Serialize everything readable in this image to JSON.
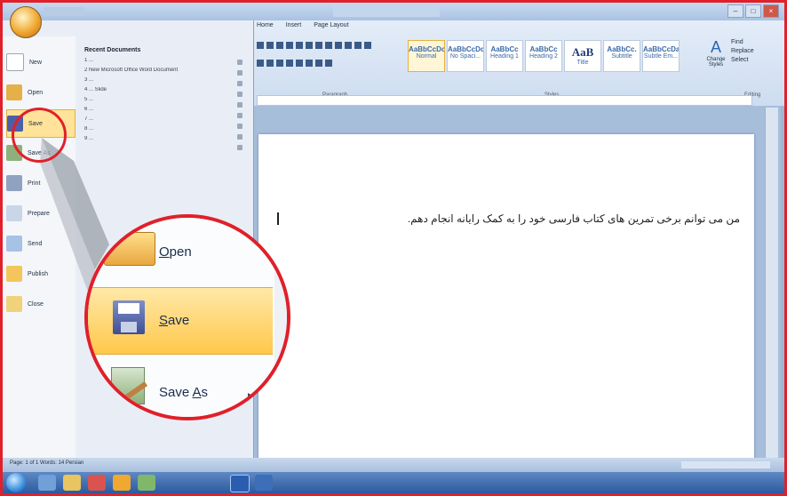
{
  "ribbon": {
    "tabs": [
      "Home",
      "Insert",
      "Page Layout"
    ],
    "styles": [
      {
        "sample": "AaBbCcDc",
        "name": "Normal"
      },
      {
        "sample": "AaBbCcDc",
        "name": "No Spaci..."
      },
      {
        "sample": "AaBbCc",
        "name": "Heading 1"
      },
      {
        "sample": "AaBbCc",
        "name": "Heading 2"
      },
      {
        "sample": "AaB",
        "name": "Title"
      },
      {
        "sample": "AaBbCc.",
        "name": "Subtitle"
      },
      {
        "sample": "AaBbCcDa",
        "name": "Subtle Em..."
      }
    ],
    "change_styles_label": "Change Styles",
    "editing": [
      "Find",
      "Replace",
      "Select"
    ],
    "group_labels": [
      "Paragraph",
      "Styles",
      "Editing"
    ]
  },
  "office_menu": {
    "left_items": [
      "New",
      "Open",
      "Save",
      "Save As",
      "Print",
      "Prepare",
      "Send",
      "Publish",
      "Close"
    ],
    "recent_title": "Recent Documents",
    "recent_items": [
      "1 ...",
      "2 New Microsoft Office Word Document",
      "3 ...",
      "4 ... Slide",
      "5 ...",
      "6 ...",
      "7 ...",
      "8 ...",
      "9 ..."
    ]
  },
  "document": {
    "text": "من می توانم برخی تمرین های کتاب فارسی خود را به کمک رایانه انجام دهم."
  },
  "zoom": {
    "open_label": "Open",
    "save_label": "Save",
    "save_as_label": "Save As"
  },
  "status_bar": {
    "text": "Page: 1 of 1   Words: 14   Persian"
  }
}
